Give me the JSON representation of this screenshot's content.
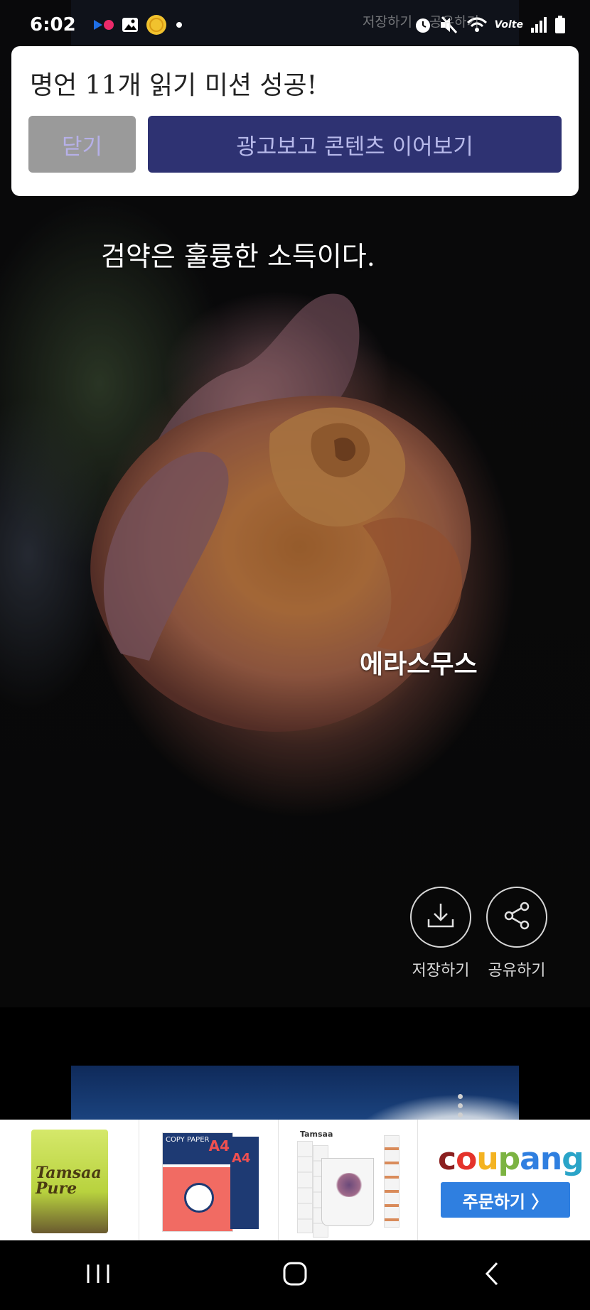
{
  "status_bar": {
    "time": "6:02",
    "network": "Volte",
    "icons": [
      "media-app-icon",
      "gallery-icon",
      "coin-icon",
      "dot-icon",
      "alarm-icon",
      "mute-icon",
      "wifi-icon",
      "signal-icon",
      "battery-icon"
    ]
  },
  "background_actions": {
    "save_label": "저장하기",
    "share_label": "공유하기"
  },
  "dialog": {
    "title": "명언 11개 읽기 미션 성공!",
    "close_label": "닫기",
    "ad_label": "광고보고 콘텐츠 이어보기"
  },
  "quote": {
    "text": "검약은 훌륭한 소득이다.",
    "author": "에라스무스"
  },
  "actions": {
    "save_label": "저장하기",
    "share_label": "공유하기"
  },
  "ad_banner": {
    "brand": "coupang",
    "brand_colors": [
      "#8b1f1f",
      "#e4332b",
      "#f4b321",
      "#7cb342",
      "#2f7fe0",
      "#2aa4c8"
    ],
    "order_label": "주문하기 〉",
    "products": [
      {
        "name_line1": "Tamsaa",
        "name_line2": "Pure"
      },
      {
        "label": "COPY PAPER",
        "size": "A4"
      },
      {
        "label": "Tamsaa"
      }
    ]
  },
  "nav": {
    "icons": [
      "recent-apps-icon",
      "home-icon",
      "back-icon"
    ]
  },
  "colors": {
    "dialog_bg": "#ffffff",
    "close_btn": "#9a9a9a",
    "ad_btn": "#2e3272",
    "order_btn": "#2f7fe0"
  }
}
